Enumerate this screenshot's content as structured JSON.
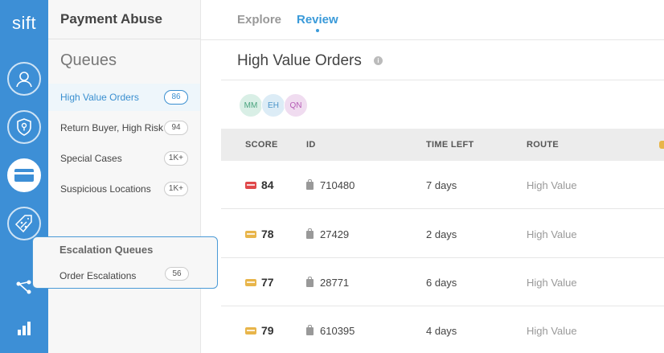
{
  "app": {
    "logo": "sift",
    "title": "Payment Abuse"
  },
  "nav": {
    "tabs": [
      {
        "label": "Explore",
        "active": false
      },
      {
        "label": "Review",
        "active": true
      }
    ]
  },
  "rail": {
    "icons": [
      "user-icon",
      "shield-icon",
      "credit-card-icon",
      "percent-tag-icon",
      "workflow-icon",
      "bar-chart-icon"
    ],
    "active": "credit-card-icon"
  },
  "sidebar": {
    "heading": "Queues",
    "items": [
      {
        "label": "High Value Orders",
        "count": "86",
        "active": true
      },
      {
        "label": "Return Buyer, High Risk",
        "count": "94",
        "active": false
      },
      {
        "label": "Special Cases",
        "count": "1K+",
        "active": false
      },
      {
        "label": "Suspicious Locations",
        "count": "1K+",
        "active": false
      }
    ],
    "escalation": {
      "heading": "Escalation Queues",
      "item": {
        "label": "Order Escalations",
        "count": "56"
      }
    }
  },
  "main": {
    "title": "High Value Orders",
    "info_icon": "i",
    "avatars": [
      {
        "initials": "MM",
        "bg": "#d9efe6",
        "fg": "#4aa37e"
      },
      {
        "initials": "EH",
        "bg": "#dcecf6",
        "fg": "#4a94c9"
      },
      {
        "initials": "QN",
        "bg": "#f0dcf0",
        "fg": "#b55bb5"
      }
    ],
    "columns": [
      "SCORE",
      "ID",
      "TIME LEFT",
      "ROUTE"
    ],
    "rows": [
      {
        "score": "84",
        "score_color": "#e0484a",
        "id": "710480",
        "time_left": "7 days",
        "route": "High Value"
      },
      {
        "score": "78",
        "score_color": "#e8b54a",
        "id": "27429",
        "time_left": "2 days",
        "route": "High Value"
      },
      {
        "score": "77",
        "score_color": "#e8b54a",
        "id": "28771",
        "time_left": "6 days",
        "route": "High Value"
      },
      {
        "score": "79",
        "score_color": "#e8b54a",
        "id": "610395",
        "time_left": "4 days",
        "route": "High Value"
      }
    ]
  },
  "colors": {
    "rail": "#3d8fd6",
    "accent": "#3a9ad9"
  }
}
